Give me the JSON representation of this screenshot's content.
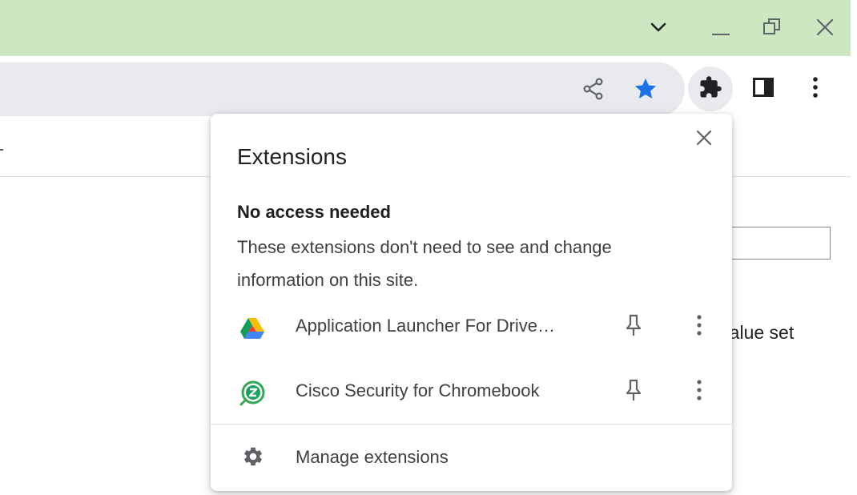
{
  "window_controls": {
    "tab_search_icon": "chevron-down-icon",
    "minimize_icon": "minimize-icon",
    "restore_icon": "restore-icon",
    "close_icon": "close-icon"
  },
  "toolbar": {
    "share_icon": "share-icon",
    "bookmark_icon": "star-icon",
    "extensions_icon": "puzzle-icon",
    "side_panel_icon": "side-panel-icon",
    "menu_icon": "more-vert-icon"
  },
  "page": {
    "partial_text": "o value set"
  },
  "extensions_popup": {
    "title": "Extensions",
    "section_heading": "No access needed",
    "section_description": "These extensions don't need to see and change information on this site.",
    "items": [
      {
        "name": "Application Launcher For Drive…",
        "icon": "google-drive-icon"
      },
      {
        "name": "Cisco Security for Chromebook",
        "icon": "cisco-security-icon"
      }
    ],
    "manage_label": "Manage extensions"
  },
  "colors": {
    "title_bar": "#cde7c3",
    "omnibox": "#e8eaed",
    "bookmark_star": "#1a73e8"
  }
}
